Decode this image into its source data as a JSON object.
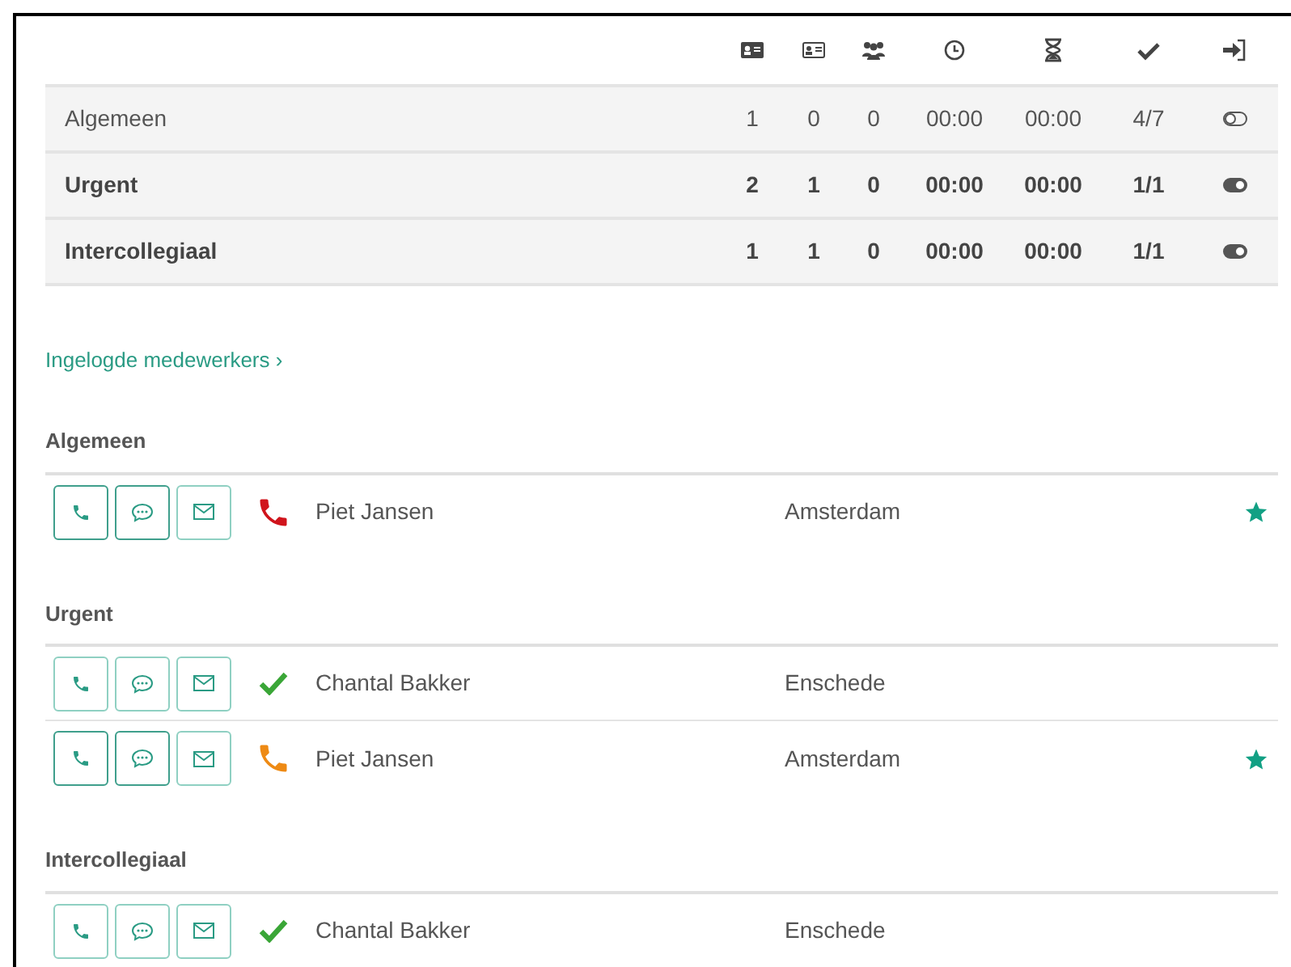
{
  "queue_table": {
    "columns": [
      {
        "kind": "card-solid"
      },
      {
        "kind": "card-outline"
      },
      {
        "kind": "group"
      },
      {
        "kind": "clock"
      },
      {
        "kind": "hourglass"
      },
      {
        "kind": "check"
      },
      {
        "kind": "login"
      }
    ],
    "rows": [
      {
        "name": "Algemeen",
        "values": [
          "1",
          "0",
          "0",
          "00:00",
          "00:00",
          "4/7"
        ],
        "on": false
      },
      {
        "name": "Urgent",
        "values": [
          "2",
          "1",
          "0",
          "00:00",
          "00:00",
          "1/1"
        ],
        "on": true
      },
      {
        "name": "Intercollegiaal",
        "values": [
          "1",
          "1",
          "0",
          "00:00",
          "00:00",
          "1/1"
        ],
        "on": true
      }
    ]
  },
  "logged_in_link": "Ingelogde medewerkers ›",
  "groups": [
    {
      "title": "Algemeen",
      "people": [
        {
          "name": "Piet Jansen",
          "city": "Amsterdam",
          "status": {
            "kind": "phone",
            "color": "#d0141c"
          },
          "favorite": true,
          "buttons": [
            {
              "kind": "phone",
              "highlighted": true
            },
            {
              "kind": "chat",
              "highlighted": true
            },
            {
              "kind": "mail",
              "highlighted": false
            }
          ]
        }
      ]
    },
    {
      "title": "Urgent",
      "people": [
        {
          "name": "Chantal Bakker",
          "city": "Enschede",
          "status": {
            "kind": "check",
            "color": "#3aa637"
          },
          "favorite": false,
          "buttons": [
            {
              "kind": "phone",
              "highlighted": false
            },
            {
              "kind": "chat",
              "highlighted": false
            },
            {
              "kind": "mail",
              "highlighted": false
            }
          ]
        },
        {
          "name": "Piet Jansen",
          "city": "Amsterdam",
          "status": {
            "kind": "phone",
            "color": "#ee8a14"
          },
          "favorite": true,
          "buttons": [
            {
              "kind": "phone",
              "highlighted": true
            },
            {
              "kind": "chat",
              "highlighted": true
            },
            {
              "kind": "mail",
              "highlighted": false
            }
          ]
        }
      ]
    },
    {
      "title": "Intercollegiaal",
      "people": [
        {
          "name": "Chantal Bakker",
          "city": "Enschede",
          "status": {
            "kind": "check",
            "color": "#3aa637"
          },
          "favorite": false,
          "buttons": [
            {
              "kind": "phone",
              "highlighted": false
            },
            {
              "kind": "chat",
              "highlighted": false
            },
            {
              "kind": "mail",
              "highlighted": false
            }
          ]
        }
      ]
    }
  ]
}
